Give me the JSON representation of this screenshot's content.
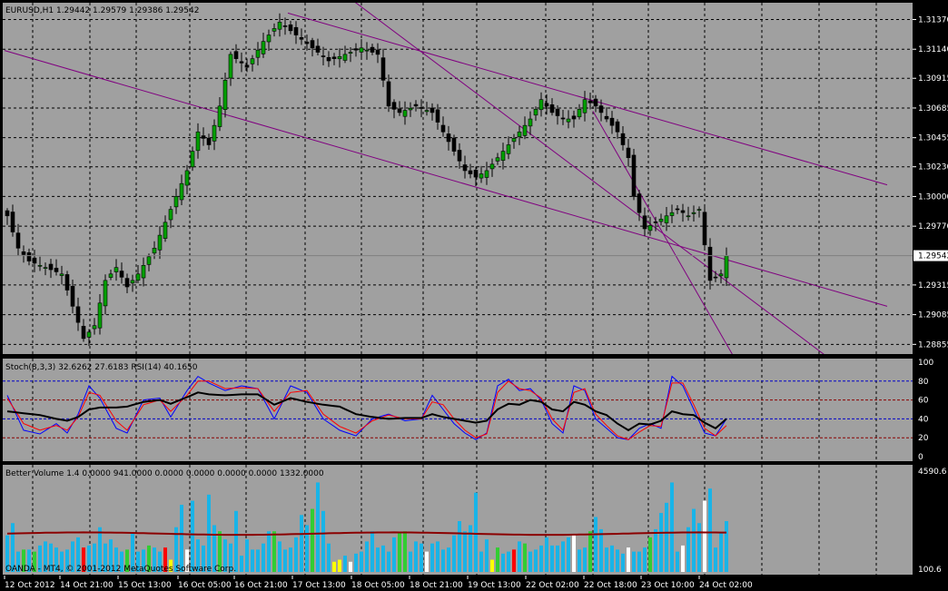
{
  "chart_data": {
    "type": "candlestick",
    "symbol_header": "EURUSD,H1  1.29442 1.29579 1.29386 1.29542",
    "price_axis": {
      "ticks": [
        "1.31370",
        "1.31140",
        "1.30915",
        "1.30685",
        "1.30455",
        "1.30230",
        "1.30000",
        "1.29770",
        "1.29315",
        "1.29085",
        "1.28855"
      ],
      "current_price": "1.29542",
      "ylim": [
        1.2878,
        1.315
      ]
    },
    "time_axis": {
      "labels": [
        "12 Oct 2012",
        "14 Oct 21:00",
        "15 Oct 13:00",
        "16 Oct 05:00",
        "16 Oct 21:00",
        "17 Oct 13:00",
        "18 Oct 05:00",
        "18 Oct 21:00",
        "19 Oct 13:00",
        "22 Oct 02:00",
        "22 Oct 18:00",
        "23 Oct 10:00",
        "24 Oct 02:00"
      ],
      "bar_count": 133
    },
    "close_anchors": [
      [
        0,
        1.2985
      ],
      [
        2,
        1.296
      ],
      [
        4,
        1.295
      ],
      [
        7,
        1.2945
      ],
      [
        10,
        1.294
      ],
      [
        12,
        1.2915
      ],
      [
        14,
        1.289
      ],
      [
        16,
        1.29
      ],
      [
        18,
        1.2935
      ],
      [
        20,
        1.2945
      ],
      [
        22,
        1.293
      ],
      [
        24,
        1.294
      ],
      [
        27,
        1.296
      ],
      [
        30,
        1.299
      ],
      [
        33,
        1.302
      ],
      [
        35,
        1.305
      ],
      [
        37,
        1.304
      ],
      [
        39,
        1.307
      ],
      [
        41,
        1.311
      ],
      [
        44,
        1.31
      ],
      [
        47,
        1.312
      ],
      [
        50,
        1.3135
      ],
      [
        53,
        1.3125
      ],
      [
        56,
        1.3115
      ],
      [
        59,
        1.3105
      ],
      [
        62,
        1.311
      ],
      [
        65,
        1.3115
      ],
      [
        68,
        1.311
      ],
      [
        70,
        1.307
      ],
      [
        72,
        1.3065
      ],
      [
        75,
        1.307
      ],
      [
        78,
        1.3065
      ],
      [
        80,
        1.305
      ],
      [
        82,
        1.3035
      ],
      [
        84,
        1.302
      ],
      [
        86,
        1.3015
      ],
      [
        88,
        1.302
      ],
      [
        90,
        1.303
      ],
      [
        92,
        1.304
      ],
      [
        94,
        1.305
      ],
      [
        96,
        1.306
      ],
      [
        98,
        1.3075
      ],
      [
        100,
        1.3065
      ],
      [
        102,
        1.306
      ],
      [
        104,
        1.306
      ],
      [
        106,
        1.3075
      ],
      [
        108,
        1.307
      ],
      [
        110,
        1.306
      ],
      [
        112,
        1.305
      ],
      [
        114,
        1.303
      ],
      [
        115,
        1.3
      ],
      [
        117,
        1.2975
      ],
      [
        119,
        1.298
      ],
      [
        121,
        1.2985
      ],
      [
        123,
        1.299
      ],
      [
        125,
        1.2985
      ],
      [
        127,
        1.299
      ],
      [
        129,
        1.2935
      ],
      [
        131,
        1.294
      ],
      [
        132,
        1.2954
      ]
    ],
    "trendlines": [
      {
        "from": [
          0,
          1.3113
        ],
        "to": [
          162,
          1.2915
        ]
      },
      {
        "from": [
          52,
          1.3142
        ],
        "to": [
          162,
          1.3009
        ]
      },
      {
        "from": [
          61,
          1.3161
        ],
        "to": [
          156,
          1.286
        ]
      },
      {
        "from": [
          108,
          1.3066
        ],
        "to": [
          136,
          1.286
        ]
      }
    ],
    "oscillator": {
      "title": "Stoch(8,3,3) 32.6262 27.6183  RSI(14) 40.1650",
      "ylim": [
        0,
        100
      ],
      "ticks": [
        "100",
        "80",
        "60",
        "40",
        "20",
        "0"
      ],
      "levels": [
        80,
        60,
        40,
        20
      ],
      "stoch_main_anchors": [
        [
          0,
          65
        ],
        [
          3,
          28
        ],
        [
          6,
          24
        ],
        [
          9,
          35
        ],
        [
          11,
          25
        ],
        [
          13,
          45
        ],
        [
          15,
          75
        ],
        [
          17,
          62
        ],
        [
          20,
          30
        ],
        [
          22,
          25
        ],
        [
          25,
          60
        ],
        [
          28,
          62
        ],
        [
          30,
          42
        ],
        [
          33,
          70
        ],
        [
          35,
          85
        ],
        [
          37,
          78
        ],
        [
          40,
          70
        ],
        [
          43,
          75
        ],
        [
          46,
          72
        ],
        [
          49,
          40
        ],
        [
          52,
          75
        ],
        [
          55,
          68
        ],
        [
          58,
          40
        ],
        [
          61,
          28
        ],
        [
          64,
          22
        ],
        [
          67,
          40
        ],
        [
          70,
          45
        ],
        [
          73,
          38
        ],
        [
          76,
          40
        ],
        [
          78,
          65
        ],
        [
          80,
          50
        ],
        [
          82,
          35
        ],
        [
          84,
          25
        ],
        [
          86,
          18
        ],
        [
          88,
          25
        ],
        [
          90,
          75
        ],
        [
          92,
          82
        ],
        [
          94,
          70
        ],
        [
          96,
          72
        ],
        [
          98,
          60
        ],
        [
          100,
          35
        ],
        [
          102,
          25
        ],
        [
          104,
          75
        ],
        [
          106,
          70
        ],
        [
          108,
          40
        ],
        [
          110,
          30
        ],
        [
          112,
          20
        ],
        [
          114,
          18
        ],
        [
          116,
          30
        ],
        [
          118,
          35
        ],
        [
          120,
          30
        ],
        [
          122,
          85
        ],
        [
          124,
          75
        ],
        [
          126,
          50
        ],
        [
          128,
          25
        ],
        [
          130,
          22
        ],
        [
          132,
          40
        ]
      ],
      "stoch_signal_anchors": [
        [
          0,
          62
        ],
        [
          3,
          35
        ],
        [
          6,
          28
        ],
        [
          9,
          33
        ],
        [
          11,
          28
        ],
        [
          13,
          42
        ],
        [
          15,
          68
        ],
        [
          17,
          65
        ],
        [
          20,
          38
        ],
        [
          22,
          28
        ],
        [
          25,
          55
        ],
        [
          28,
          60
        ],
        [
          30,
          48
        ],
        [
          33,
          65
        ],
        [
          35,
          80
        ],
        [
          37,
          80
        ],
        [
          40,
          72
        ],
        [
          43,
          73
        ],
        [
          46,
          72
        ],
        [
          49,
          48
        ],
        [
          52,
          68
        ],
        [
          55,
          70
        ],
        [
          58,
          45
        ],
        [
          61,
          32
        ],
        [
          64,
          25
        ],
        [
          67,
          38
        ],
        [
          70,
          44
        ],
        [
          73,
          40
        ],
        [
          76,
          40
        ],
        [
          78,
          58
        ],
        [
          80,
          55
        ],
        [
          82,
          40
        ],
        [
          84,
          28
        ],
        [
          86,
          20
        ],
        [
          88,
          24
        ],
        [
          90,
          68
        ],
        [
          92,
          80
        ],
        [
          94,
          72
        ],
        [
          96,
          70
        ],
        [
          98,
          62
        ],
        [
          100,
          40
        ],
        [
          102,
          28
        ],
        [
          104,
          68
        ],
        [
          106,
          72
        ],
        [
          108,
          45
        ],
        [
          110,
          33
        ],
        [
          112,
          22
        ],
        [
          114,
          18
        ],
        [
          116,
          26
        ],
        [
          118,
          33
        ],
        [
          120,
          32
        ],
        [
          122,
          78
        ],
        [
          124,
          78
        ],
        [
          126,
          55
        ],
        [
          128,
          30
        ],
        [
          130,
          22
        ],
        [
          132,
          33
        ]
      ],
      "rsi_anchors": [
        [
          0,
          48
        ],
        [
          3,
          46
        ],
        [
          6,
          44
        ],
        [
          9,
          40
        ],
        [
          11,
          38
        ],
        [
          13,
          42
        ],
        [
          15,
          50
        ],
        [
          17,
          52
        ],
        [
          20,
          52
        ],
        [
          22,
          53
        ],
        [
          25,
          58
        ],
        [
          28,
          60
        ],
        [
          30,
          56
        ],
        [
          33,
          63
        ],
        [
          35,
          68
        ],
        [
          37,
          66
        ],
        [
          40,
          65
        ],
        [
          43,
          66
        ],
        [
          46,
          66
        ],
        [
          49,
          55
        ],
        [
          52,
          62
        ],
        [
          55,
          58
        ],
        [
          58,
          55
        ],
        [
          61,
          53
        ],
        [
          64,
          45
        ],
        [
          67,
          42
        ],
        [
          70,
          40
        ],
        [
          73,
          41
        ],
        [
          76,
          41
        ],
        [
          78,
          45
        ],
        [
          80,
          42
        ],
        [
          82,
          40
        ],
        [
          84,
          38
        ],
        [
          86,
          36
        ],
        [
          88,
          38
        ],
        [
          90,
          50
        ],
        [
          92,
          56
        ],
        [
          94,
          55
        ],
        [
          96,
          60
        ],
        [
          98,
          58
        ],
        [
          100,
          50
        ],
        [
          102,
          48
        ],
        [
          104,
          58
        ],
        [
          106,
          55
        ],
        [
          108,
          48
        ],
        [
          110,
          44
        ],
        [
          112,
          35
        ],
        [
          114,
          28
        ],
        [
          116,
          35
        ],
        [
          118,
          34
        ],
        [
          120,
          38
        ],
        [
          122,
          48
        ],
        [
          124,
          45
        ],
        [
          126,
          44
        ],
        [
          128,
          36
        ],
        [
          130,
          30
        ],
        [
          132,
          40
        ]
      ]
    },
    "volume": {
      "title": "Better Volume 1.4  0.0000 941.0000 0.0000 0.0000 0.0000 0.0000 1332.0000",
      "ticks": [
        "4590.6",
        "100.6"
      ],
      "values": [
        18,
        24,
        10,
        11,
        11,
        10,
        13,
        15,
        14,
        12,
        10,
        11,
        15,
        17,
        12,
        13,
        14,
        22,
        14,
        16,
        12,
        10,
        11,
        19,
        10,
        11,
        13,
        12,
        10,
        12,
        6,
        22,
        33,
        11,
        35,
        16,
        13,
        38,
        23,
        20,
        16,
        14,
        30,
        8,
        16,
        11,
        11,
        14,
        20,
        20,
        15,
        11,
        12,
        17,
        28,
        23,
        31,
        44,
        30,
        14,
        5,
        6,
        8,
        5,
        9,
        10,
        15,
        20,
        12,
        13,
        10,
        17,
        19,
        20,
        10,
        15,
        14,
        10,
        14,
        15,
        11,
        12,
        18,
        25,
        20,
        23,
        39,
        10,
        16,
        6,
        12,
        9,
        10,
        11,
        15,
        14,
        10,
        11,
        13,
        17,
        13,
        13,
        15,
        17,
        18,
        11,
        12,
        20,
        27,
        21,
        12,
        13,
        11,
        9,
        12,
        10,
        10,
        12,
        17,
        21,
        29,
        34,
        44,
        10,
        13,
        22,
        31,
        24,
        35,
        41,
        12,
        19,
        25
      ],
      "highlight_bars": [
        [
          14,
          "red"
        ],
        [
          29,
          "red"
        ],
        [
          33,
          "white"
        ],
        [
          63,
          "white"
        ],
        [
          77,
          "white"
        ],
        [
          93,
          "red"
        ],
        [
          104,
          "white"
        ],
        [
          114,
          "white"
        ],
        [
          124,
          "white"
        ],
        [
          128,
          "white"
        ]
      ],
      "ma_level": 1730
    },
    "copyright": "OANDA - MT4, © 2001-2012 MetaQuotes Software Corp."
  }
}
